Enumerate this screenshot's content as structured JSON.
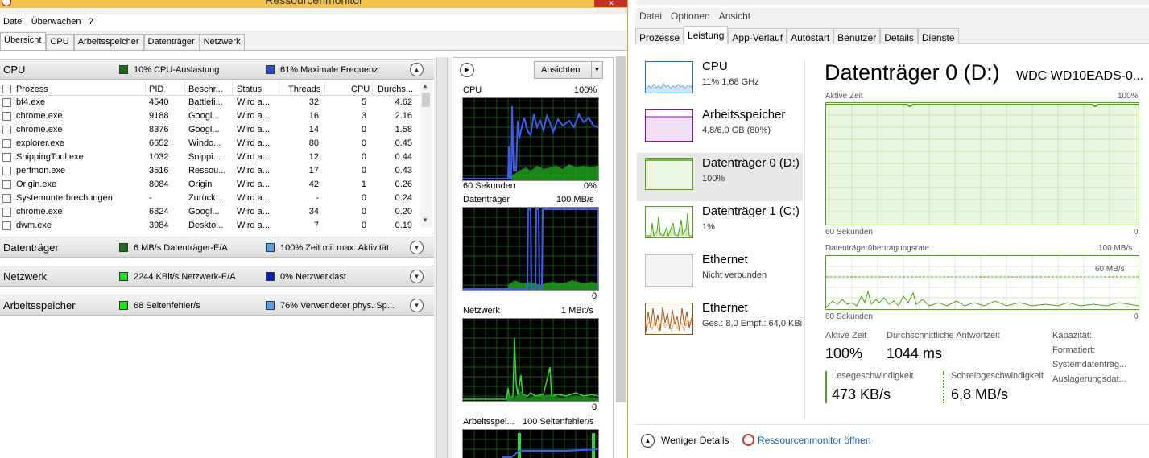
{
  "rm": {
    "title": "Ressourcenmonitor",
    "close": "✕",
    "menu": [
      "Datei",
      "Überwachen",
      "?"
    ],
    "tabs": [
      "Übersicht",
      "CPU",
      "Arbeitsspeicher",
      "Datenträger",
      "Netzwerk"
    ],
    "cpu": {
      "title": "CPU",
      "sum1": "10% CPU-Auslastung",
      "sum2": "61% Maximale Frequenz",
      "colors": {
        "usage": "#16a016",
        "freq": "#2c4bd2"
      },
      "headers": [
        "Prozess",
        "PID",
        "Beschr...",
        "Status",
        "Threads",
        "CPU",
        "Durchs..."
      ],
      "rows": [
        [
          "bf4.exe",
          "4540",
          "Battlefi...",
          "Wird a...",
          "32",
          "5",
          "4.62"
        ],
        [
          "chrome.exe",
          "9188",
          "Googl...",
          "Wird a...",
          "16",
          "3",
          "2.16"
        ],
        [
          "chrome.exe",
          "8376",
          "Googl...",
          "Wird a...",
          "14",
          "0",
          "1.58"
        ],
        [
          "explorer.exe",
          "6652",
          "Windo...",
          "Wird a...",
          "80",
          "0",
          "0.45"
        ],
        [
          "SnippingTool.exe",
          "1032",
          "Snippi...",
          "Wird a...",
          "12",
          "0",
          "0.44"
        ],
        [
          "perfmon.exe",
          "3516",
          "Ressou...",
          "Wird a...",
          "17",
          "0",
          "0.43"
        ],
        [
          "Origin.exe",
          "8084",
          "Origin",
          "Wird a...",
          "42",
          "1",
          "0.26"
        ],
        [
          "Systemunterbrechungen",
          "-",
          "Zurück...",
          "Wird a...",
          "-",
          "0",
          "0.24"
        ],
        [
          "chrome.exe",
          "6824",
          "Googl...",
          "Wird a...",
          "34",
          "0",
          "0.20"
        ],
        [
          "dwm.exe",
          "3984",
          "Deskto...",
          "Wird a...",
          "7",
          "0",
          "0.19"
        ]
      ]
    },
    "disk": {
      "title": "Datenträger",
      "sum1": "6 MB/s Datenträger-E/A",
      "sum2": "100% Zeit mit max. Aktivität"
    },
    "net": {
      "title": "Netzwerk",
      "sum1": "2244 KBit/s Netzwerk-E/A",
      "sum2": "0% Netzwerklast"
    },
    "mem": {
      "title": "Arbeitsspeicher",
      "sum1": "68 Seitenfehler/s",
      "sum2": "76% Verwendeter phys. Sp..."
    },
    "view_button": "Ansichten",
    "graphs": [
      {
        "name": "CPU",
        "max": "100%",
        "time": "60 Sekunden",
        "min": "0%"
      },
      {
        "name": "Datenträger",
        "max": "100 MB/s",
        "min": "0"
      },
      {
        "name": "Netzwerk",
        "max": "1 MBit/s",
        "min": "0"
      },
      {
        "name": "Arbeitsspei...",
        "max": "100 Seitenfehler/s"
      }
    ]
  },
  "tm": {
    "menu": [
      "Datei",
      "Optionen",
      "Ansicht"
    ],
    "tabs": [
      "Prozesse",
      "Leistung",
      "App-Verlauf",
      "Autostart",
      "Benutzer",
      "Details",
      "Dienste"
    ],
    "sidebar": [
      {
        "name": "CPU",
        "sub": "11% 1,68 GHz",
        "color": "#1777c4"
      },
      {
        "name": "Arbeitsspeicher",
        "sub": "4,8/6,0 GB (80%)",
        "color": "#8b12ae"
      },
      {
        "name": "Datenträger 0 (D:)",
        "sub": "100%",
        "color": "#4da60c"
      },
      {
        "name": "Datenträger 1 (C:)",
        "sub": "1%",
        "color": "#4da60c"
      },
      {
        "name": "Ethernet",
        "sub": "Nicht verbunden",
        "color": "#c0c0c0"
      },
      {
        "name": "Ethernet",
        "sub": "Ges.: 8,0  Empf.: 64,0 KBi",
        "color": "#a74f01"
      }
    ],
    "main": {
      "title": "Datenträger 0 (D:)",
      "model": "WDC WD10EADS-0...",
      "chart1_label": "Aktive Zeit",
      "chart1_max": "100%",
      "chart1_time": "60 Sekunden",
      "chart1_min": "0",
      "chart2_label": "Datenträgerübertragungsrate",
      "chart2_max": "100 MB/s",
      "chart2_mark": "60 MB/s",
      "chart2_time": "60 Sekunden",
      "chart2_min": "0",
      "active_label": "Aktive Zeit",
      "active_value": "100%",
      "resp_label": "Durchschnittliche Antwortzeit",
      "resp_value": "1044 ms",
      "read_label": "Lesegeschwindigkeit",
      "read_value": "473 KB/s",
      "write_label": "Schreibgeschwindigkeit",
      "write_value": "6,8 MB/s",
      "props": [
        "Kapazität:",
        "Formatiert:",
        "Systemdatenträg...",
        "Auslagerungsdat..."
      ]
    },
    "footer": {
      "fewer": "Weniger Details",
      "open_rm": "Ressourcenmonitor öffnen"
    }
  }
}
